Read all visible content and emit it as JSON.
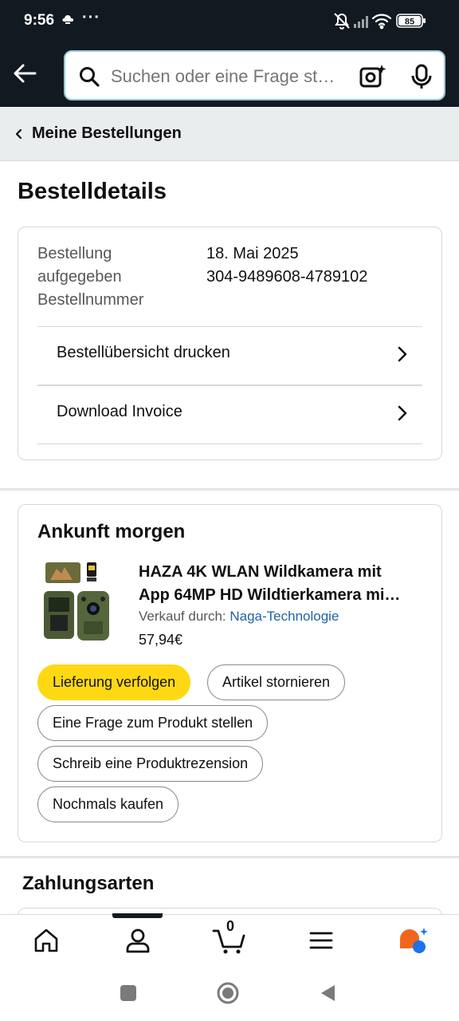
{
  "status_bar": {
    "time": "9:56",
    "more": "···",
    "battery": "85"
  },
  "search": {
    "placeholder": "Suchen oder eine Frage st…"
  },
  "breadcrumb": {
    "label": "Meine Bestellungen"
  },
  "page_title": "Bestelldetails",
  "order_info": {
    "placed_label": "Bestellung aufgegeben",
    "placed_label_l1": "Bestellung",
    "placed_label_l2": "aufgegeben",
    "placed_value": "18. Mai 2025",
    "number_label": "Bestellnummer",
    "number_value": "304-9489608-4789102"
  },
  "links": {
    "print": "Bestellübersicht drucken",
    "invoice": "Download Invoice"
  },
  "shipment": {
    "arrival": "Ankunft morgen",
    "product_title_l1": "HAZA 4K WLAN Wildkamera mit",
    "product_title_l2": "App 64MP HD Wildtierkamera mi…",
    "seller_prefix": "Verkauf durch:",
    "seller_name": "Naga-Technologie",
    "price": "57,94€"
  },
  "actions": {
    "track": "Lieferung verfolgen",
    "cancel": "Artikel stornieren",
    "question": "Eine Frage zum Produkt stellen",
    "review": "Schreib eine Produktrezension",
    "buy_again": "Nochmals kaufen"
  },
  "payment": {
    "title": "Zahlungsarten"
  },
  "bottom_nav": {
    "cart_count": "0"
  },
  "colors": {
    "header": "#131921",
    "primary_button": "#ffd814",
    "link": "#2162a1",
    "breadcrumb_bg": "#eaeded"
  }
}
